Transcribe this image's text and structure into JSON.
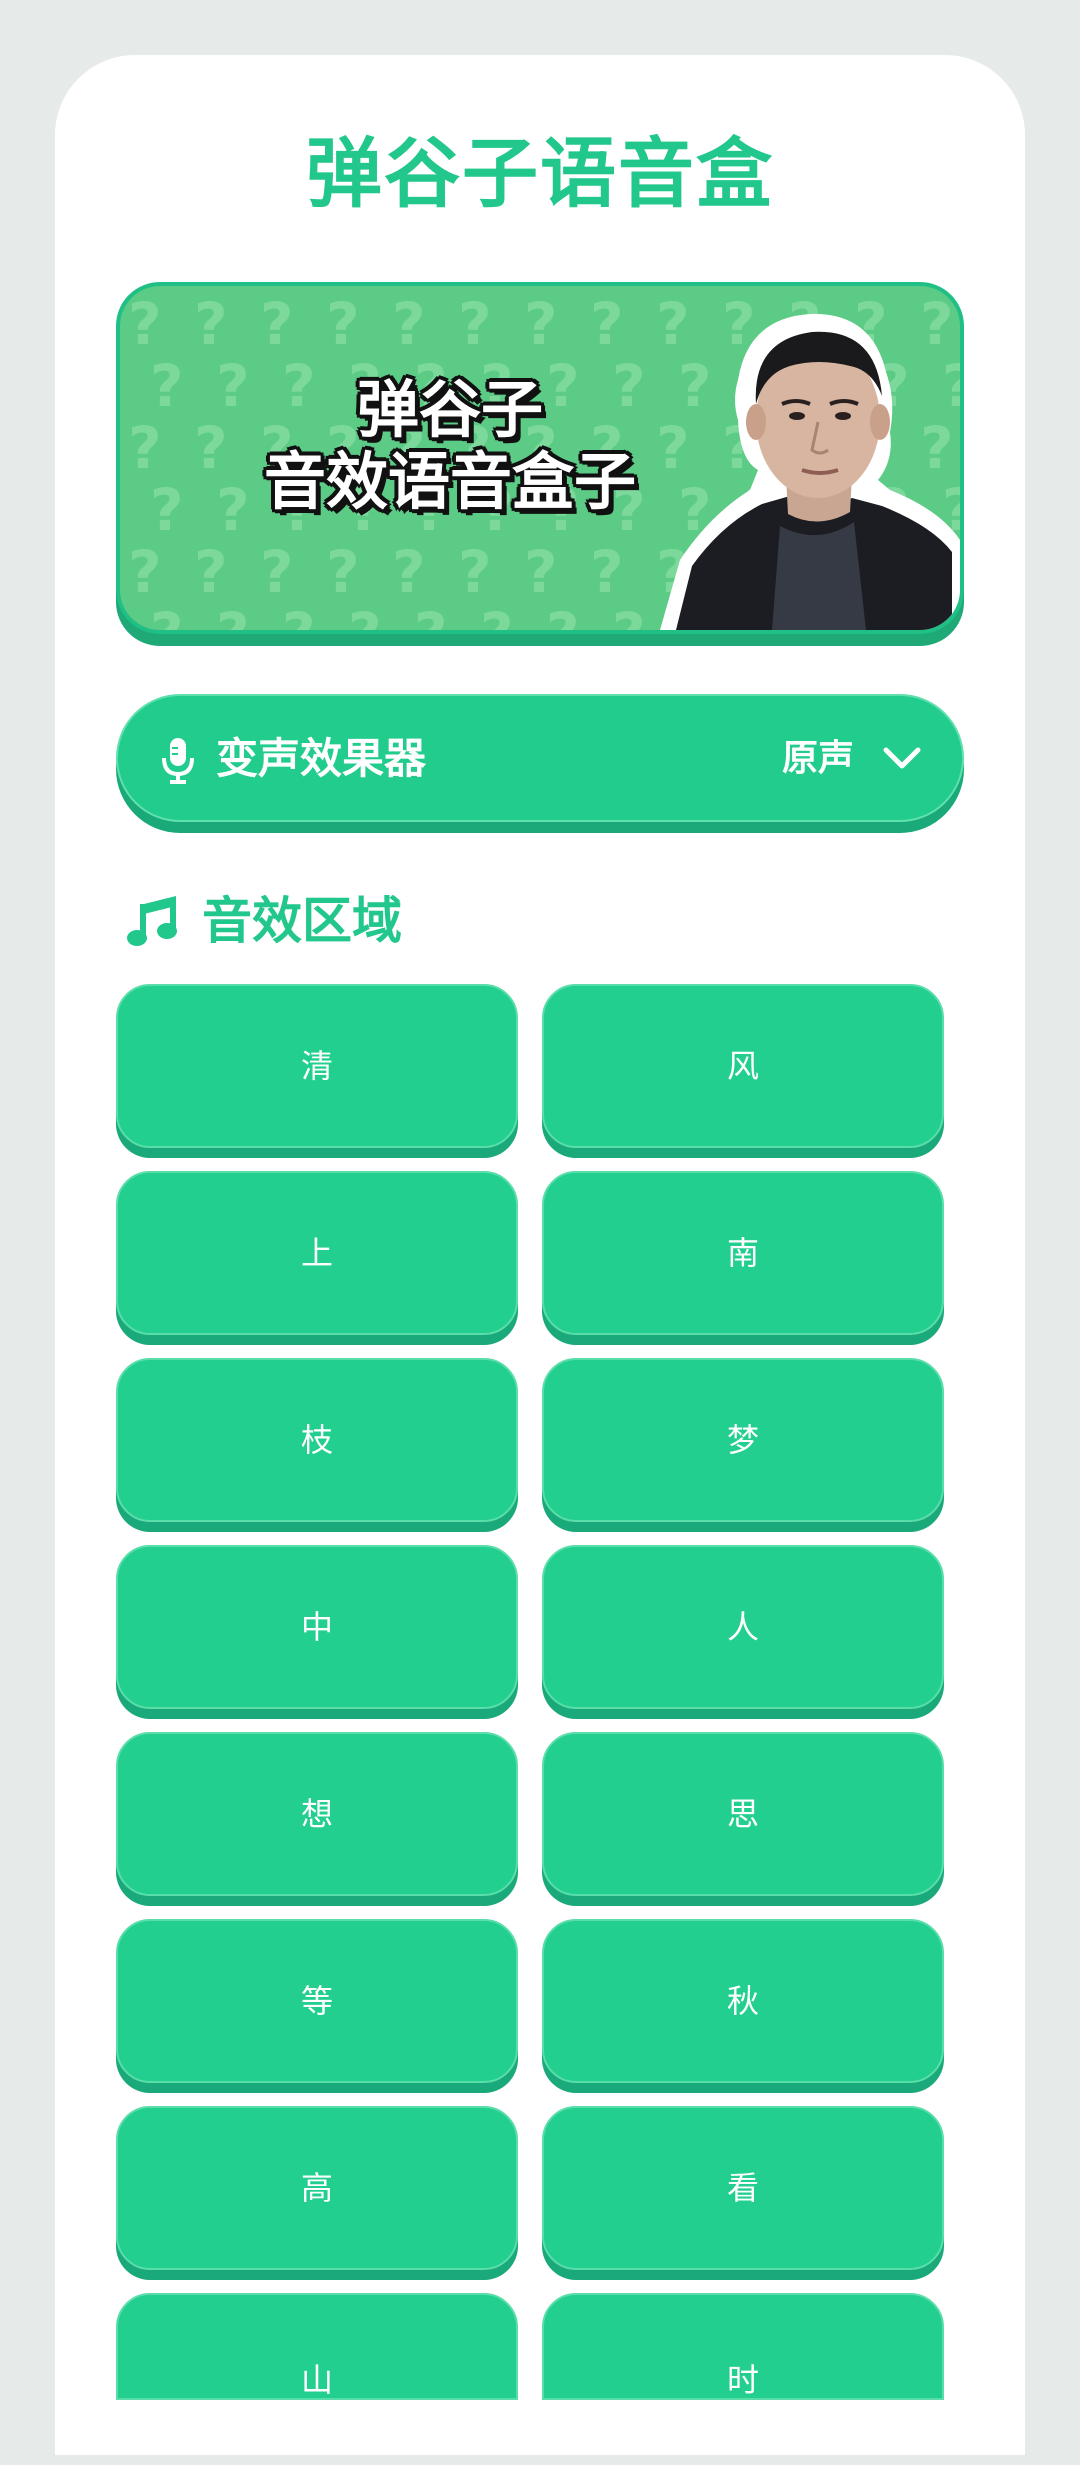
{
  "app": {
    "title": "弹谷子语音盒"
  },
  "banner": {
    "line1": "弹谷子",
    "line2": "音效语音盒子",
    "pattern_glyph": "?",
    "colors": {
      "background": "#5ccb85",
      "border": "#1fbf86"
    }
  },
  "voice_changer": {
    "icon": "microphone-icon",
    "label": "变声效果器",
    "selected": "原声",
    "dropdown_icon": "chevron-down-icon"
  },
  "sound_section": {
    "icon": "music-note-icon",
    "title": "音效区域",
    "buttons": [
      {
        "label": "清"
      },
      {
        "label": "风"
      },
      {
        "label": "上"
      },
      {
        "label": "南"
      },
      {
        "label": "枝"
      },
      {
        "label": "梦"
      },
      {
        "label": "中"
      },
      {
        "label": "人"
      },
      {
        "label": "想"
      },
      {
        "label": "思"
      },
      {
        "label": "等"
      },
      {
        "label": "秋"
      },
      {
        "label": "高"
      },
      {
        "label": "看"
      },
      {
        "label": "山"
      },
      {
        "label": "时"
      }
    ]
  },
  "colors": {
    "accent": "#22c78c",
    "button": "#22cf8f",
    "button_shadow": "#1aa97a",
    "page_background": "#e6eae8",
    "card_background": "#ffffff"
  }
}
